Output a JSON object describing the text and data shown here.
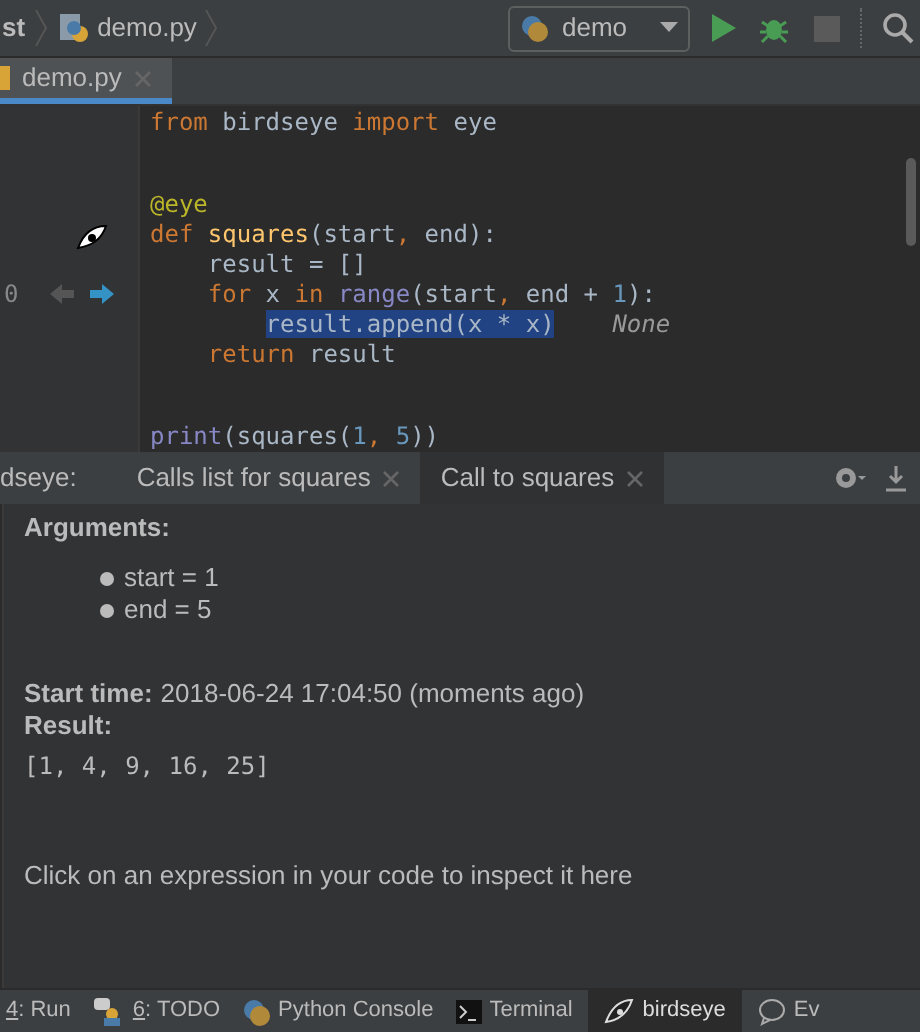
{
  "navbar": {
    "project": "st",
    "file": "demo.py",
    "run_config": "demo"
  },
  "editor_tabs": [
    {
      "label": "demo.py",
      "selected": true
    }
  ],
  "code_lines": [
    {
      "kind": "code",
      "segments": [
        {
          "text": "from",
          "kind": "keyword"
        },
        {
          "text": " birdseye ",
          "kind": "plain"
        },
        {
          "text": "import",
          "kind": "keyword"
        },
        {
          "text": " eye",
          "kind": "plain"
        }
      ]
    },
    {
      "kind": "blank"
    },
    {
      "kind": "blank"
    },
    {
      "kind": "code",
      "segments": [
        {
          "text": "@eye",
          "kind": "decorator"
        }
      ]
    },
    {
      "kind": "traced",
      "segments": [
        {
          "text": "def ",
          "kind": "keyword"
        },
        {
          "text": "squares",
          "kind": "function"
        },
        {
          "text": "(start",
          "kind": "plain"
        },
        {
          "text": ", ",
          "kind": "keyword"
        },
        {
          "text": "end):",
          "kind": "plain"
        }
      ]
    },
    {
      "kind": "code",
      "segments": [
        {
          "text": "    result = []",
          "kind": "plain"
        }
      ]
    },
    {
      "kind": "loop",
      "gutter_text": "0",
      "segments": [
        {
          "text": "    for",
          "kind": "keyword"
        },
        {
          "text": " x ",
          "kind": "plain"
        },
        {
          "text": "in ",
          "kind": "keyword"
        },
        {
          "text": "range",
          "kind": "builtin"
        },
        {
          "text": "(start",
          "kind": "plain"
        },
        {
          "text": ", ",
          "kind": "keyword"
        },
        {
          "text": "end + ",
          "kind": "plain"
        },
        {
          "text": "1",
          "kind": "number"
        },
        {
          "text": "):",
          "kind": "plain"
        }
      ]
    },
    {
      "kind": "code",
      "segments": [
        {
          "text": "        result.append(x * x)",
          "kind": "selected"
        },
        {
          "text": "    None",
          "kind": "annotation"
        }
      ]
    },
    {
      "kind": "code",
      "segments": [
        {
          "text": "    return",
          "kind": "keyword"
        },
        {
          "text": " result",
          "kind": "plain"
        }
      ]
    },
    {
      "kind": "blank"
    },
    {
      "kind": "blank"
    },
    {
      "kind": "code",
      "segments": [
        {
          "text": "print",
          "kind": "builtin"
        },
        {
          "text": "(squares(",
          "kind": "plain"
        },
        {
          "text": "1",
          "kind": "number"
        },
        {
          "text": ", ",
          "kind": "keyword"
        },
        {
          "text": "5",
          "kind": "number"
        },
        {
          "text": "))",
          "kind": "plain"
        }
      ]
    }
  ],
  "tool_window": {
    "title": "dseye:",
    "tabs": [
      {
        "label": "Calls list for squares",
        "selected": false
      },
      {
        "label": "Call to squares",
        "selected": true
      }
    ]
  },
  "call_details": {
    "arguments_label": "Arguments:",
    "arguments": [
      "start = 1",
      "end = 5"
    ],
    "start_time_label": "Start time:",
    "start_time": "2018-06-24 17:04:50 (moments ago)",
    "result_label": "Result:",
    "result": "[1, 4, 9, 16, 25]",
    "hint": "Click on an expression in your code to inspect it here"
  },
  "bottom_bar": [
    {
      "kind": "run",
      "key": "4",
      "label": ": Run",
      "selected": false
    },
    {
      "kind": "todo",
      "key": "6",
      "label": ": TODO",
      "selected": false
    },
    {
      "kind": "console",
      "label": "Python Console",
      "selected": false
    },
    {
      "kind": "terminal",
      "label": "Terminal",
      "selected": false
    },
    {
      "kind": "birdseye",
      "label": "birdseye",
      "selected": true
    },
    {
      "kind": "event",
      "label": "Ev",
      "selected": false
    }
  ]
}
